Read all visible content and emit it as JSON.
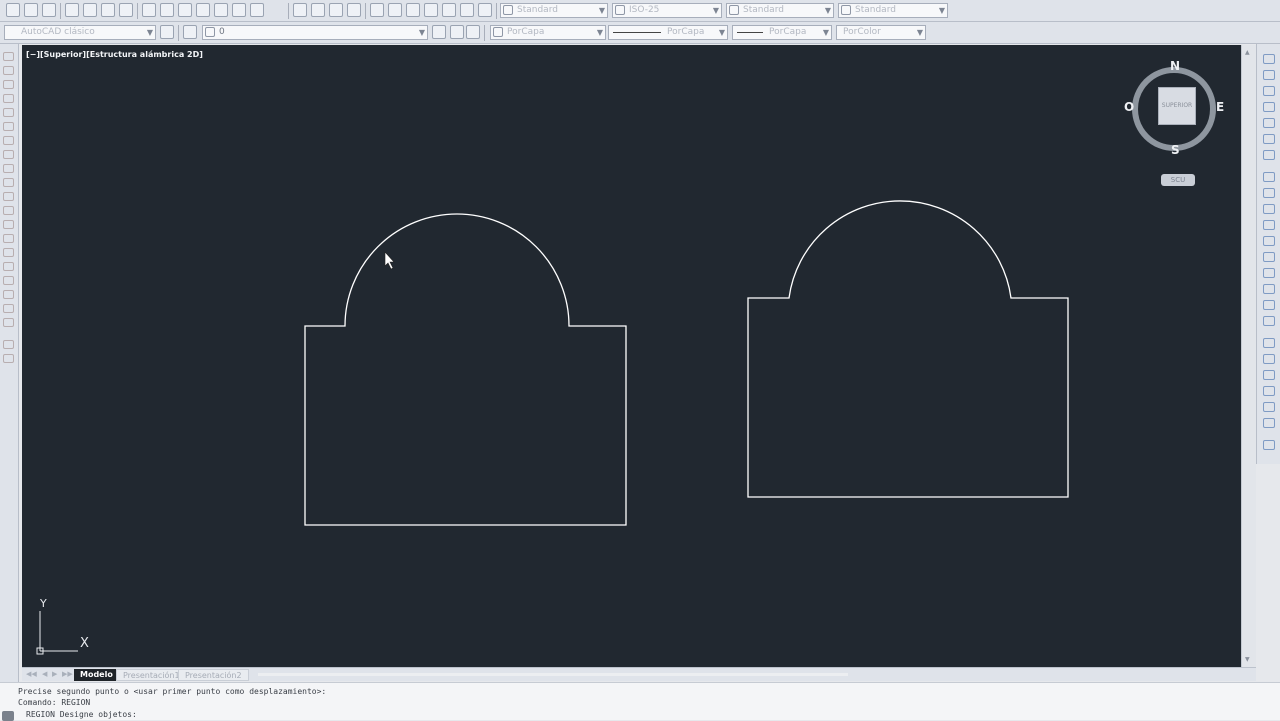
{
  "toolbar_top": {
    "text_style": "Standard",
    "dim_style": "ISO-25",
    "table_style": "Standard",
    "mleader_style": "Standard"
  },
  "toolbar_props": {
    "workspace": "AutoCAD clásico",
    "layer": "0",
    "color": "PorCapa",
    "linetype": "PorCapa",
    "lineweight": "PorCapa",
    "plotstyle": "PorColor"
  },
  "viewport": {
    "label": "[−][Superior][Estructura alámbrica 2D]"
  },
  "viewcube": {
    "face": "SUPERIOR",
    "north": "N",
    "south": "S",
    "east": "E",
    "west": "O",
    "wcs": "SCU"
  },
  "ucs_icon": {
    "x": "X",
    "y": "Y"
  },
  "layout_tabs": [
    {
      "label": "Modelo",
      "active": true
    },
    {
      "label": "Presentación1",
      "active": false
    },
    {
      "label": "Presentación2",
      "active": false
    }
  ],
  "command_history": [
    "Precise segundo punto o <usar primer punto como desplazamiento>:",
    "Comando: REGION",
    "REGION Designe objetos:"
  ],
  "colors": {
    "canvas": "#212830",
    "geometry": "#ffffff",
    "toolbar": "#dfe3ea"
  }
}
